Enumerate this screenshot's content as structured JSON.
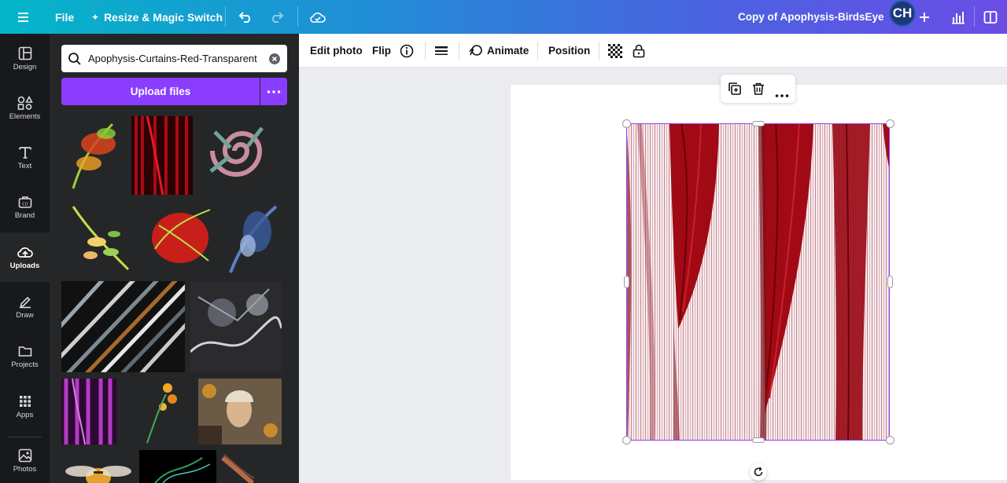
{
  "topbar": {
    "file_label": "File",
    "resize_label": "Resize & Magic Switch",
    "doc_title": "Copy of Apophysis-BirdsEye",
    "avatar_initials": "CH"
  },
  "rail": {
    "items": [
      {
        "label": "Design",
        "icon": "layout-icon"
      },
      {
        "label": "Elements",
        "icon": "shapes-icon"
      },
      {
        "label": "Text",
        "icon": "text-icon"
      },
      {
        "label": "Brand",
        "icon": "brand-icon"
      },
      {
        "label": "Uploads",
        "icon": "cloud-upload-icon",
        "active": true
      },
      {
        "label": "Draw",
        "icon": "pen-icon"
      },
      {
        "label": "Projects",
        "icon": "folder-icon"
      },
      {
        "label": "Apps",
        "icon": "apps-grid-icon"
      },
      {
        "label": "Photos",
        "icon": "photo-icon"
      }
    ]
  },
  "panel": {
    "search_value": "Apophysis-Curtains-Red-Transparent",
    "upload_label": "Upload files"
  },
  "toolbar": {
    "edit_photo": "Edit photo",
    "flip": "Flip",
    "animate": "Animate",
    "position": "Position"
  },
  "colors": {
    "accent": "#8b3dff",
    "rail_bg": "#18191b",
    "panel_bg": "#252627",
    "curtain_red": "#a10a14"
  }
}
